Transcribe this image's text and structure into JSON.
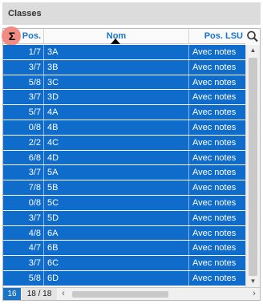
{
  "panel": {
    "title": "Classes"
  },
  "table": {
    "headers": {
      "sigma": "Σ",
      "pos": "Pos.",
      "nom": "Nom",
      "lsu": "Pos. LSU"
    },
    "sorted_column": "Nom",
    "sort_direction": "ascending",
    "rows": [
      {
        "pos": "1/7",
        "nom": "3A",
        "lsu": "Avec notes"
      },
      {
        "pos": "3/7",
        "nom": "3B",
        "lsu": "Avec notes"
      },
      {
        "pos": "5/8",
        "nom": "3C",
        "lsu": "Avec notes"
      },
      {
        "pos": "3/7",
        "nom": "3D",
        "lsu": "Avec notes"
      },
      {
        "pos": "5/7",
        "nom": "4A",
        "lsu": "Avec notes"
      },
      {
        "pos": "0/8",
        "nom": "4B",
        "lsu": "Avec notes"
      },
      {
        "pos": "2/2",
        "nom": "4C",
        "lsu": "Avec notes"
      },
      {
        "pos": "6/8",
        "nom": "4D",
        "lsu": "Avec notes"
      },
      {
        "pos": "3/7",
        "nom": "5A",
        "lsu": "Avec notes"
      },
      {
        "pos": "7/8",
        "nom": "5B",
        "lsu": "Avec notes"
      },
      {
        "pos": "0/8",
        "nom": "5C",
        "lsu": "Avec notes"
      },
      {
        "pos": "3/7",
        "nom": "5D",
        "lsu": "Avec notes"
      },
      {
        "pos": "4/8",
        "nom": "6A",
        "lsu": "Avec notes"
      },
      {
        "pos": "4/7",
        "nom": "6B",
        "lsu": "Avec notes"
      },
      {
        "pos": "3/7",
        "nom": "6C",
        "lsu": "Avec notes"
      },
      {
        "pos": "5/8",
        "nom": "6D",
        "lsu": "Avec notes"
      }
    ]
  },
  "footer": {
    "selected_count": "16",
    "count_text": "18 / 18"
  },
  "icons": {
    "search": "search-icon",
    "sort": "sort-ascending-icon",
    "scroll_up": "scroll-up-icon",
    "scroll_down": "scroll-down-icon",
    "scroll_left": "scroll-left-icon",
    "scroll_right": "scroll-right-icon"
  },
  "colors": {
    "selection": "#0f6ccb",
    "header_text": "#1a73c7",
    "sigma_highlight": "#f28b82",
    "panel_header_bg": "#dcdcdc"
  }
}
